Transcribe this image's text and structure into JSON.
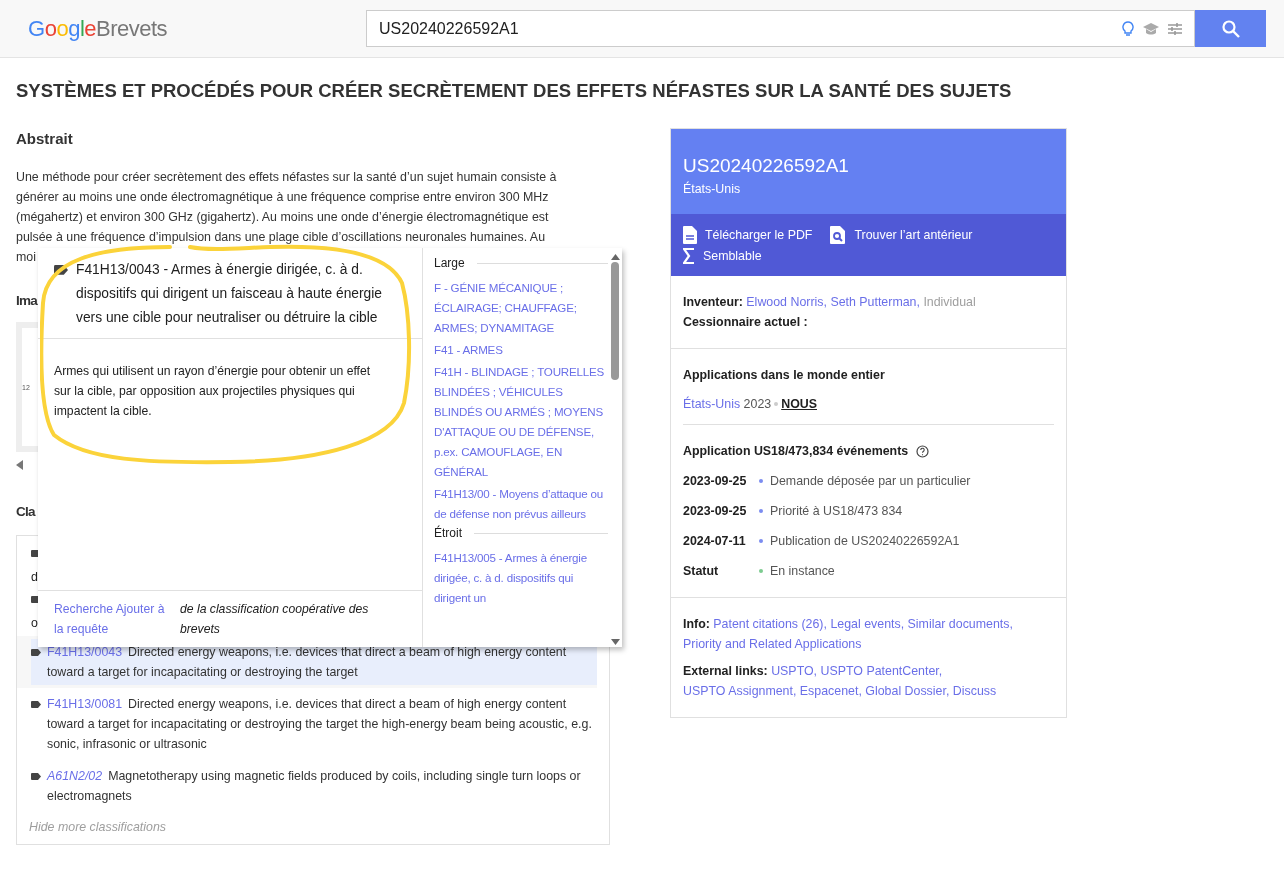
{
  "header": {
    "logo": {
      "brand": "Google",
      "product": "Brevets"
    },
    "search": {
      "value": "US20240226592A1"
    }
  },
  "title": "SYSTÈMES ET PROCÉDÉS POUR CRÉER SECRÈTEMENT DES EFFETS NÉFASTES SUR LA SANTÉ DES SUJETS",
  "abstract": {
    "heading": "Abstrait",
    "lines": [
      "Une méthode pour créer secrètement des effets néfastes sur la santé d’un sujet humain consiste à",
      "générer au moins une onde électromagnétique à une fréquence comprise entre environ 300 MHz",
      "(mégahertz) et environ 300 GHz (gigahertz). Au moins une onde d’énergie électromagnétique est",
      "pulsée à une fréquence d’impulsion dans une plage cible d’oscillations neuronales humaines. Au",
      "moi"
    ]
  },
  "images": {
    "heading": "Ima",
    "figure_label": "12"
  },
  "classifications": {
    "heading": "Cla",
    "rows": [
      {
        "kind": "partial",
        "text": "d"
      },
      {
        "kind": "partial",
        "text": "o"
      },
      {
        "kind": "full",
        "code": "F41H13/0043",
        "description": "Directed energy weapons, i.e. devices that direct a beam of high energy content toward a target for incapacitating or destroying the target",
        "selected": true,
        "italic": false
      },
      {
        "kind": "full",
        "code": "F41H13/0081",
        "description": "Directed energy weapons, i.e. devices that direct a beam of high energy content toward a target for incapacitating or destroying the target the high-energy beam being acoustic, e.g. sonic, infrasonic or ultrasonic",
        "selected": false,
        "italic": false
      },
      {
        "kind": "full",
        "code": "A61N2/02",
        "description": "Magnetotherapy using magnetic fields produced by coils, including single turn loops or electromagnets",
        "selected": false,
        "italic": true
      }
    ],
    "toggle": "Hide more classifications"
  },
  "popup": {
    "title": "F41H13/0043 - Armes à énergie dirigée, c. à d. dispositifs qui dirigent un faisceau à haute énergie vers une cible pour neutraliser ou détruire la cible",
    "description": "Armes qui utilisent un rayon d’énergie pour obtenir un effet sur la cible, par opposition aux projectiles physiques qui impactent la cible.",
    "footer_link": "Recherche Ajouter à la requête",
    "footer_note": "de la classification coopérative des brevets",
    "groups": [
      {
        "heading": "Large",
        "links": [
          "F - GÉNIE MÉCANIQUE ; ÉCLAIRAGE; CHAUFFAGE; ARMES; DYNAMITAGE",
          "F41 - ARMES",
          "F41H - BLINDAGE ; TOURELLES BLINDÉES ; VÉHICULES BLINDÉS OU ARMÉS ; MOYENS D'ATTAQUE OU DE DÉFENSE, p.ex. CAMOUFLAGE, EN GÉNÉRAL",
          "F41H13/00 - Moyens d’attaque ou de défense non prévus ailleurs"
        ]
      },
      {
        "heading": "Étroit",
        "links": [
          "F41H13/005 - Armes à énergie dirigée, c. à d. dispositifs qui dirigent un"
        ]
      }
    ]
  },
  "card": {
    "number": "US20240226592A1",
    "country": "États-Unis",
    "actions": [
      {
        "kind": "pdf",
        "label": "Télécharger le PDF"
      },
      {
        "kind": "prior",
        "label": "Trouver l’art antérieur"
      },
      {
        "kind": "similar",
        "label": "Semblable"
      }
    ],
    "inventor_label": "Inventeur:",
    "inventors": [
      "Elwood Norris,",
      "Seth Putterman,"
    ],
    "inventor_type": "Individual",
    "assignee_label": "Cessionnaire actuel :",
    "worldwide": {
      "heading": "Applications dans le monde entier",
      "country": "États-Unis",
      "year": "2023",
      "code": "NOUS"
    },
    "events": {
      "heading": "Application US18/473,834 événements",
      "items": [
        {
          "date": "2023-09-25",
          "text": "Demande déposée par un particulier",
          "color": "#7b8cf0"
        },
        {
          "date": "2023-09-25",
          "text": "Priorité à US18/473 834",
          "color": "#7b8cf0"
        },
        {
          "date": "2024-07-11",
          "text": "Publication de US20240226592A1",
          "color": "#7b8cf0"
        },
        {
          "date": "Statut",
          "text": "En instance",
          "color": "#7ccb8f"
        }
      ]
    },
    "info": {
      "label": "Info:",
      "links": [
        "Patent citations (26),",
        "Legal events,",
        "Similar documents,",
        "Priority and Related Applications"
      ]
    },
    "external": {
      "label": "External links:",
      "links": [
        "USPTO,",
        "USPTO PatentCenter,",
        "USPTO Assignment,",
        "Espacenet,",
        "Global Dossier,",
        "Discuss"
      ]
    }
  }
}
